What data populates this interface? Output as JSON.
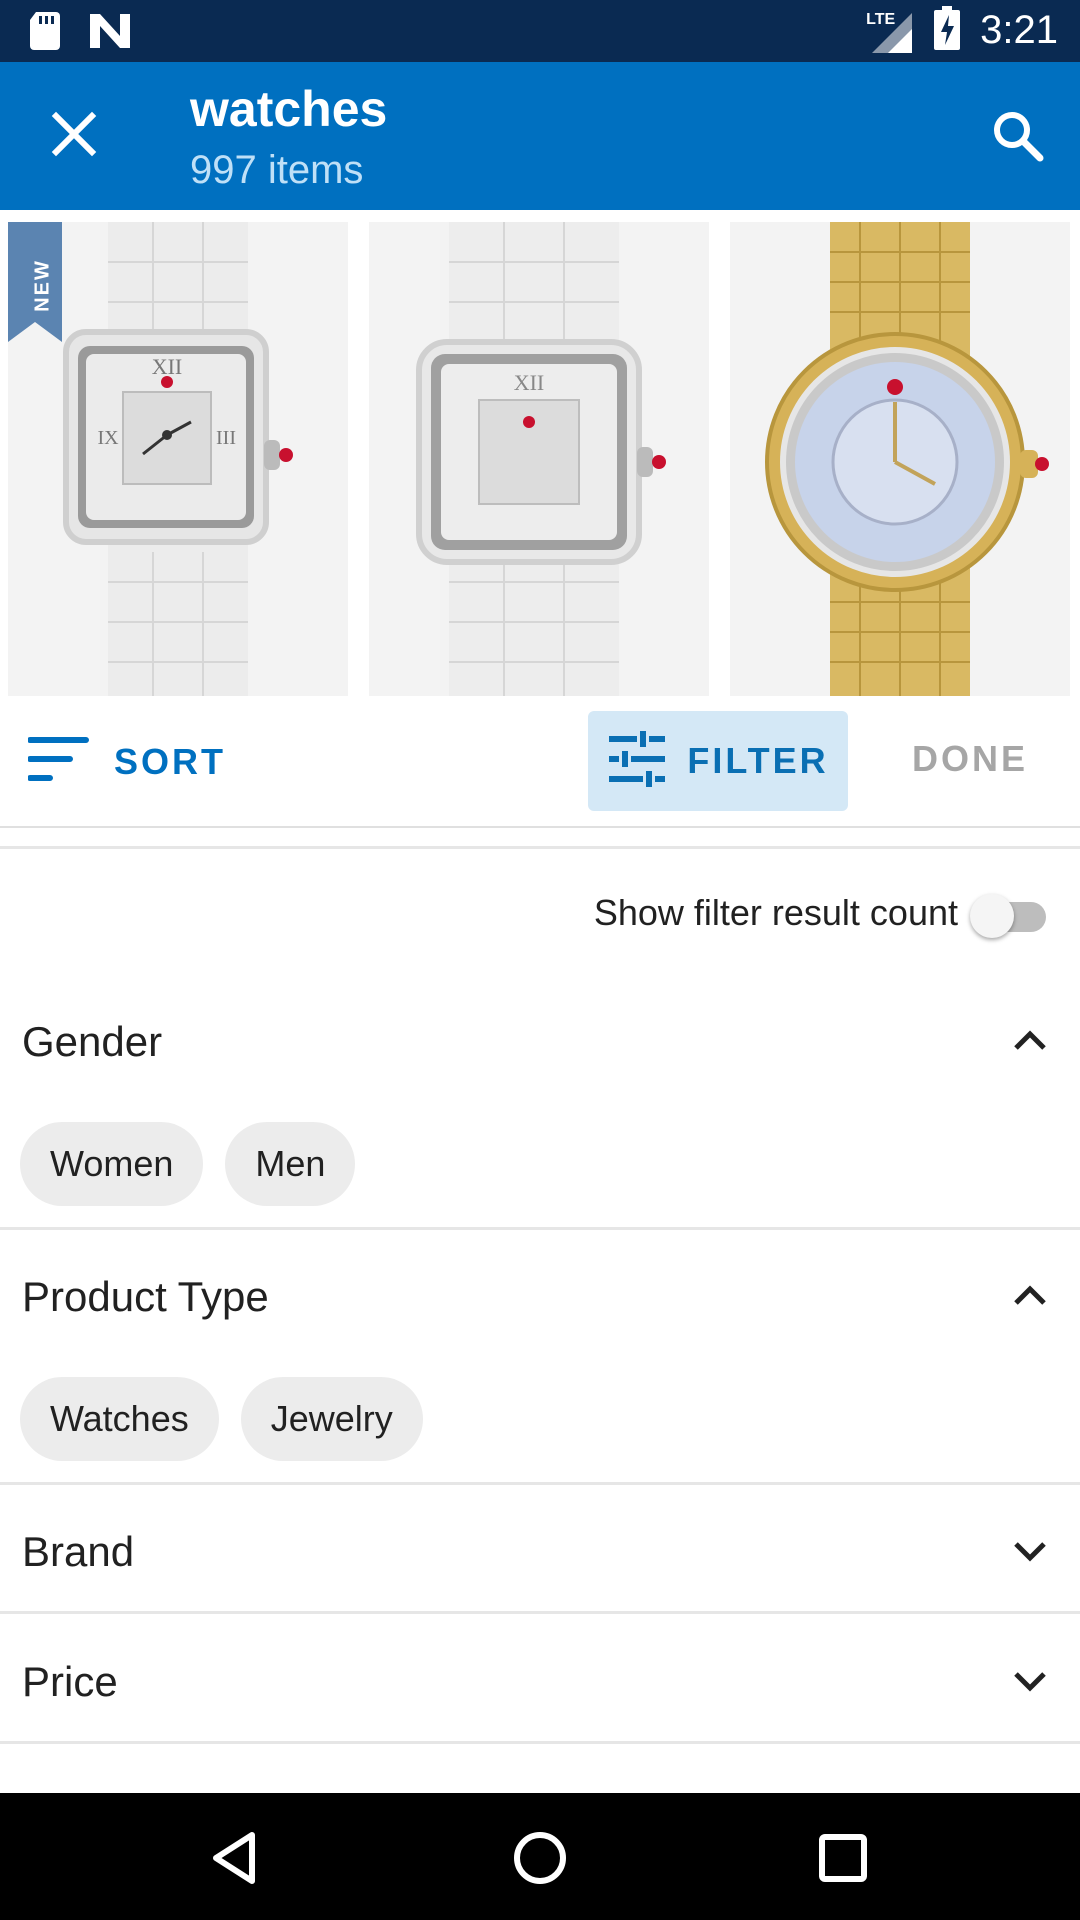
{
  "status_bar": {
    "time": "3:21",
    "network": "LTE",
    "left_icons": [
      "sd-card-icon",
      "n-logo-icon"
    ],
    "right_icons": [
      "signal-icon",
      "battery-charging-icon"
    ]
  },
  "app_bar": {
    "title": "watches",
    "subtitle": "997 items",
    "close_icon": "close-icon",
    "search_icon": "search-icon",
    "color": "#0070c0"
  },
  "products": [
    {
      "name": "white-ceramic-square-watch",
      "badge": "NEW"
    },
    {
      "name": "white-ceramic-square-watch-2",
      "badge": ""
    },
    {
      "name": "gold-round-watch",
      "badge": ""
    }
  ],
  "toolbar": {
    "sort_label": "SORT",
    "filter_label": "FILTER",
    "done_label": "DONE"
  },
  "toggle_row": {
    "label": "Show filter result count",
    "enabled": false
  },
  "filters": {
    "gender": {
      "title": "Gender",
      "expanded": true,
      "options": [
        "Women",
        "Men"
      ]
    },
    "product_type": {
      "title": "Product Type",
      "expanded": true,
      "options": [
        "Watches",
        "Jewelry"
      ]
    },
    "brand": {
      "title": "Brand",
      "expanded": false
    },
    "price": {
      "title": "Price",
      "expanded": false
    }
  },
  "nav_bar": {
    "back_icon": "back-icon",
    "home_icon": "home-icon",
    "recents_icon": "recents-icon"
  },
  "colors": {
    "status_bar": "#0a2a52",
    "accent": "#0070c0",
    "filter_active_bg": "#d4e8f6",
    "chip_bg": "#ececec"
  }
}
